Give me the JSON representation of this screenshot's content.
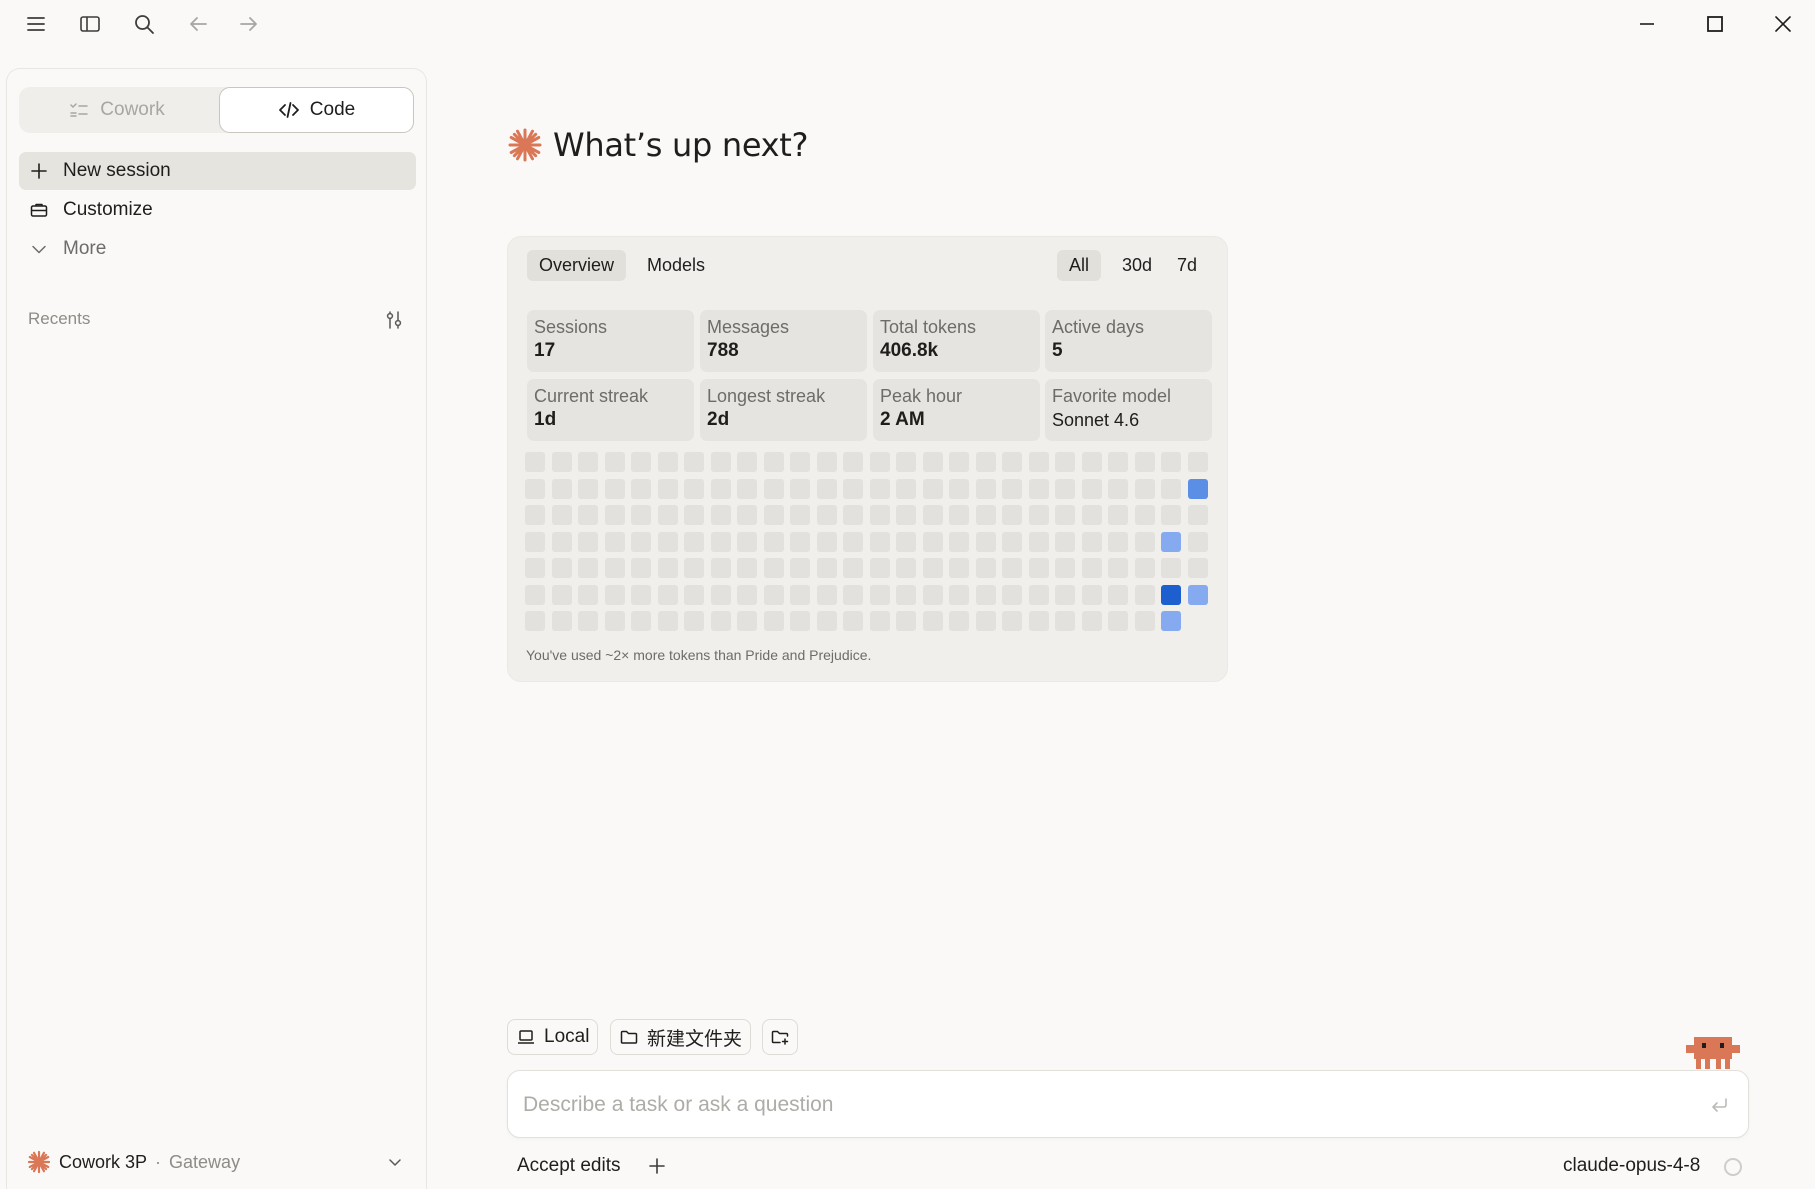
{
  "colors": {
    "accent": "#d97757",
    "heat_empty": "#e3e1dd",
    "heat_light": "#86aaf0",
    "heat_mid": "#5b8fe6",
    "heat_dark": "#1e5fd0"
  },
  "titlebar": {
    "icons": [
      "menu-icon",
      "sidebar-toggle-icon",
      "search-icon",
      "back-arrow-icon",
      "forward-arrow-icon"
    ],
    "window_controls": [
      "minimize-icon",
      "maximize-icon",
      "close-icon"
    ]
  },
  "sidebar": {
    "mode_tabs": [
      {
        "label": "Cowork",
        "icon": "checklist-icon",
        "active": false
      },
      {
        "label": "Code",
        "icon": "code-icon",
        "active": true
      }
    ],
    "nav": [
      {
        "label": "New session",
        "icon": "plus-icon"
      },
      {
        "label": "Customize",
        "icon": "briefcase-icon"
      },
      {
        "label": "More",
        "icon": "chevron-down-icon"
      }
    ],
    "recents_label": "Recents",
    "account": {
      "name": "Cowork 3P",
      "separator": "·",
      "provider": "Gateway"
    }
  },
  "main": {
    "greeting": "What’s up next?"
  },
  "stats": {
    "tabs": [
      "Overview",
      "Models"
    ],
    "ranges": [
      "All",
      "30d",
      "7d"
    ],
    "selected_tab": "Overview",
    "selected_range": "All",
    "cards": [
      {
        "label": "Sessions",
        "value": "17"
      },
      {
        "label": "Messages",
        "value": "788"
      },
      {
        "label": "Total tokens",
        "value": "406.8k"
      },
      {
        "label": "Active days",
        "value": "5"
      },
      {
        "label": "Current streak",
        "value": "1d"
      },
      {
        "label": "Longest streak",
        "value": "2d"
      },
      {
        "label": "Peak hour",
        "value": "2 AM"
      },
      {
        "label": "Favorite model",
        "value": "Sonnet 4.6"
      }
    ],
    "heatmap": {
      "columns": 26,
      "rows": 7,
      "last_column_rows": 6,
      "active_cells": [
        {
          "col": 25,
          "row": 1,
          "level": "mid"
        },
        {
          "col": 24,
          "row": 3,
          "level": "light"
        },
        {
          "col": 24,
          "row": 5,
          "level": "dark"
        },
        {
          "col": 25,
          "row": 5,
          "level": "light"
        },
        {
          "col": 24,
          "row": 6,
          "level": "light"
        }
      ]
    },
    "footnote": "You've used ~2× more tokens than Pride and Prejudice."
  },
  "composer": {
    "env_label": "Local",
    "folder_label": "新建文件夹",
    "placeholder": "Describe a task or ask a question",
    "value": "",
    "accept_label": "Accept edits",
    "model": "claude-opus-4-8"
  }
}
